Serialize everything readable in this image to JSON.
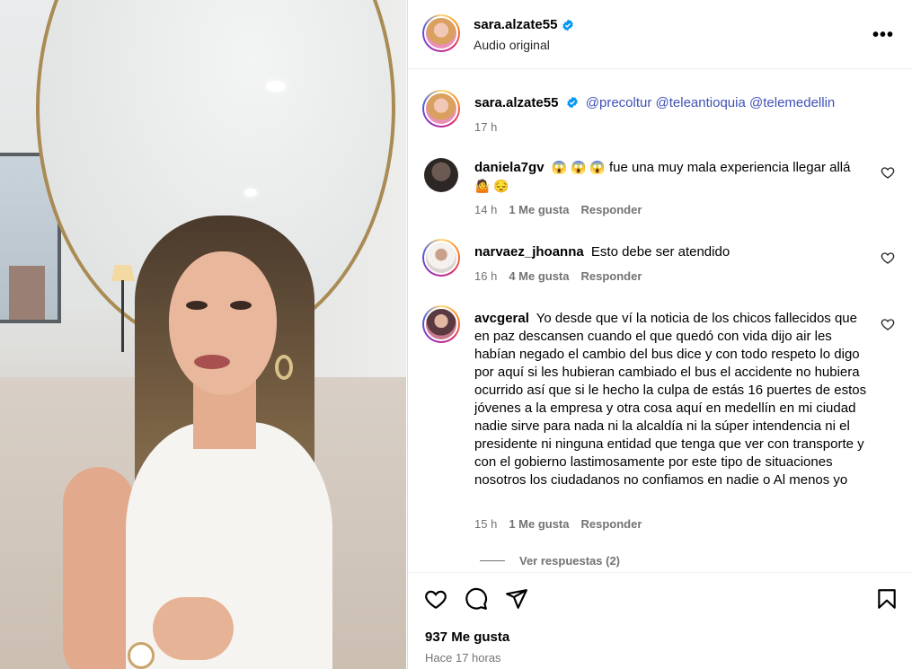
{
  "post": {
    "username": "sara.alzate55",
    "subtitle": "Audio original",
    "more_icon": "more-horizontal-icon"
  },
  "caption": {
    "username": "sara.alzate55",
    "mentions": [
      "@precoltur",
      "@teleantioquia",
      "@telemedellin"
    ],
    "time": "17 h"
  },
  "comments": [
    {
      "username": "daniela7gv",
      "text_emojis": "😱 😱 😱",
      "text": "fue una muy mala experiencia llegar allá",
      "text_emojis_2": "🤷 😔",
      "time": "14 h",
      "likes": "1 Me gusta",
      "reply": "Responder"
    },
    {
      "username": "narvaez_jhoanna",
      "text": "Esto debe ser atendido",
      "time": "16 h",
      "likes": "4 Me gusta",
      "reply": "Responder"
    },
    {
      "username": "avcgeral",
      "text": "Yo desde que ví la noticia de los chicos fallecidos que en paz descansen cuando el que quedó con vida dijo air les habían negado el cambio del bus dice y con todo respeto lo digo por aquí si les hubieran cambiado el bus el accidente no hubiera ocurrido así que si le hecho la culpa de estás 16 puertes de estos jóvenes a la empresa y otra cosa aquí en medellín en mi ciudad nadie sirve para nada ni la alcaldía ni la súper intendencia ni el presidente ni ninguna entidad que tenga que ver con transporte y con el gobierno lastimosamente por este tipo de situaciones nosotros los ciudadanos no confiamos en nadie o Al menos yo",
      "time": "15 h",
      "likes": "1 Me gusta",
      "reply": "Responder"
    }
  ],
  "view_replies": "Ver respuestas (2)",
  "footer": {
    "likes": "937 Me gusta",
    "time": "Hace 17 horas"
  },
  "colors": {
    "mention": "#4051b5",
    "verified": "#0095f6",
    "secondary_text": "#737373"
  }
}
